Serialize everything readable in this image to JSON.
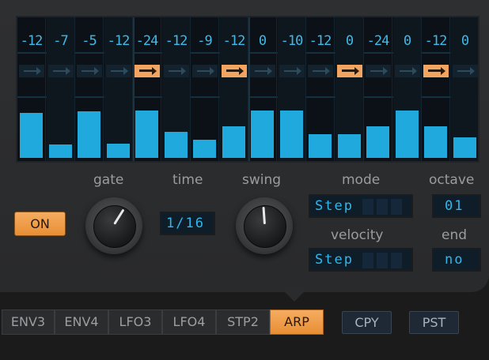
{
  "steps": [
    {
      "transpose": "-12",
      "arrow": false,
      "level": 0.44
    },
    {
      "transpose": "-7",
      "arrow": false,
      "level": 0.13
    },
    {
      "transpose": "-5",
      "arrow": false,
      "level": 0.45
    },
    {
      "transpose": "-12",
      "arrow": false,
      "level": 0.14
    },
    {
      "transpose": "-24",
      "arrow": true,
      "level": 0.46
    },
    {
      "transpose": "-12",
      "arrow": false,
      "level": 0.25
    },
    {
      "transpose": "-9",
      "arrow": false,
      "level": 0.18
    },
    {
      "transpose": "-12",
      "arrow": true,
      "level": 0.31
    },
    {
      "transpose": "0",
      "arrow": false,
      "level": 0.46
    },
    {
      "transpose": "-10",
      "arrow": false,
      "level": 0.46
    },
    {
      "transpose": "-12",
      "arrow": false,
      "level": 0.23
    },
    {
      "transpose": "0",
      "arrow": true,
      "level": 0.23
    },
    {
      "transpose": "-24",
      "arrow": false,
      "level": 0.31
    },
    {
      "transpose": "0",
      "arrow": false,
      "level": 0.46
    },
    {
      "transpose": "-12",
      "arrow": true,
      "level": 0.31
    },
    {
      "transpose": "0",
      "arrow": false,
      "level": 0.2
    }
  ],
  "controls": {
    "on_label": "ON",
    "gate_label": "gate",
    "time_label": "time",
    "time_value": "1/16",
    "swing_label": "swing",
    "mode_label": "mode",
    "mode_value": "Step",
    "octave_label": "octave",
    "octave_value": "01",
    "velocity_label": "velocity",
    "velocity_value": "Step",
    "end_label": "end",
    "end_value": "no"
  },
  "tabs": [
    {
      "label": "ENV3",
      "active": false
    },
    {
      "label": "ENV4",
      "active": false
    },
    {
      "label": "LFO3",
      "active": false
    },
    {
      "label": "LFO4",
      "active": false
    },
    {
      "label": "STP2",
      "active": false
    },
    {
      "label": "ARP",
      "active": true
    }
  ],
  "buttons": {
    "copy_label": "CPY",
    "paste_label": "PST"
  },
  "colors": {
    "accent_orange": "#f2a560",
    "lcd_blue": "#20a9dd"
  }
}
